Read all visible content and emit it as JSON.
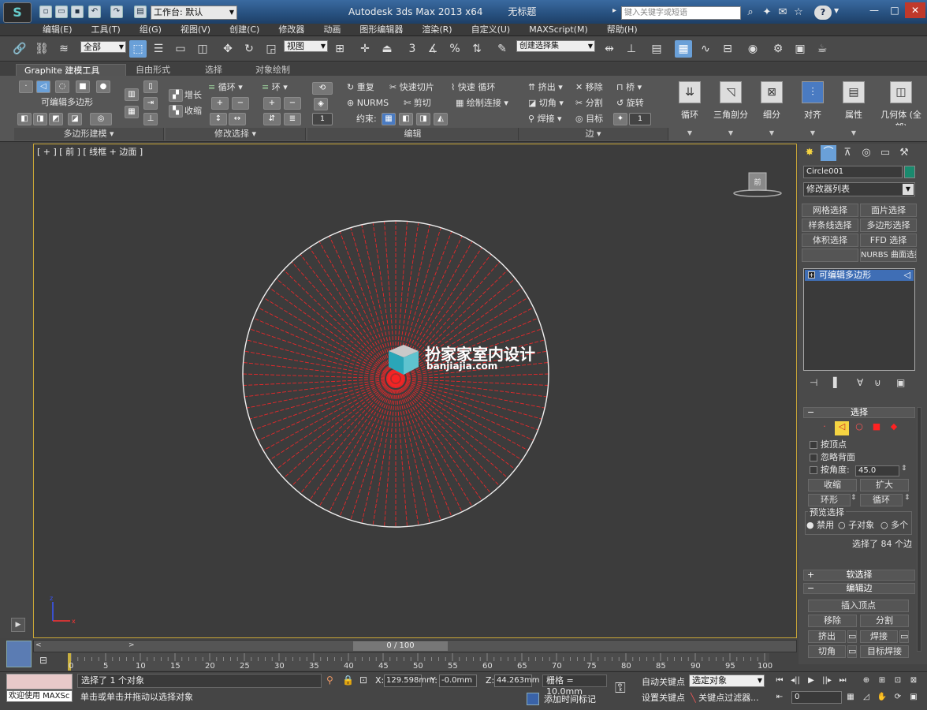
{
  "title_bar": {
    "app_title": "Autodesk 3ds Max  2013 x64",
    "doc_title": "无标题",
    "workspace": "工作台: 默认",
    "search_placeholder": "键入关键字或短语",
    "help": "?"
  },
  "menu": [
    "编辑(E)",
    "工具(T)",
    "组(G)",
    "视图(V)",
    "创建(C)",
    "修改器",
    "动画",
    "图形编辑器",
    "渲染(R)",
    "自定义(U)",
    "MAXScript(M)",
    "帮助(H)"
  ],
  "main_toolbar": {
    "selection_filter": "全部",
    "ref_coord": "视图",
    "named_selection": "创建选择集",
    "snap_angle_label": "3"
  },
  "ribbon": {
    "tabs": [
      "Graphite 建模工具",
      "自由形式",
      "选择",
      "对象绘制"
    ],
    "panels": [
      "多边形建模",
      "修改选择",
      "编辑",
      "边"
    ],
    "poly_modeling": {
      "label": "可编辑多边形"
    },
    "modify_sel": {
      "grow": "增长",
      "shrink": "收缩",
      "loop": "循环",
      "ring": "环"
    },
    "edit": {
      "repeat": "重复",
      "quickslice": "快速切片",
      "quickloop": "快速 循环",
      "nurms": "NURMS",
      "cut": "剪切",
      "paint_connect": "绘制连接",
      "constraint": "约束:",
      "constraint_val": "1"
    },
    "edges": {
      "extrude": "挤出",
      "remove": "移除",
      "bridge": "桥",
      "chamfer": "切角",
      "split": "分割",
      "spin": "旋转",
      "weld": "焊接",
      "target": "目标",
      "spin_val": "1"
    },
    "big_buttons": [
      "循环",
      "三角剖分",
      "细分",
      "对齐",
      "属性",
      "几何体 (全部)"
    ]
  },
  "viewport": {
    "label": "[ + ] [ 前 ] [ 线框 + 边面 ]",
    "watermark_text": "扮家家室内设计",
    "watermark_url": "banjiajia.com",
    "axis_x": "x",
    "axis_z": "z",
    "viewcube": "前",
    "wire_color": "#e8282a",
    "rim_color": "#f0f0f0",
    "spoke_count": 84
  },
  "command_panel": {
    "object_name": "Circle001",
    "object_color": "#1a8a6e",
    "modifier_list": "修改器列表",
    "mod_buttons": [
      "网格选择",
      "面片选择",
      "样条线选择",
      "多边形选择",
      "体积选择",
      "FFD 选择",
      "NURBS 曲面选择"
    ],
    "stack_item": "可编辑多边形",
    "selection": {
      "title": "选择",
      "by_vertex": "按顶点",
      "ignore_backfacing": "忽略背面",
      "by_angle": "按角度:",
      "angle_value": "45.0",
      "shrink": "收缩",
      "grow": "扩大",
      "ring": "环形",
      "loop": "循环",
      "preview": "预览选择",
      "preview_opts": [
        "禁用",
        "子对象",
        "多个"
      ],
      "status": "选择了 84 个边"
    },
    "soft_sel": "软选择",
    "edit_edges": {
      "title": "编辑边",
      "insert_vertex": "插入顶点",
      "remove": "移除",
      "split": "分割",
      "extrude": "挤出",
      "weld": "焊接",
      "chamfer": "切角",
      "target_weld": "目标焊接"
    }
  },
  "timeline": {
    "slider": "0 / 100",
    "ticks": [
      "0",
      "5",
      "10",
      "15",
      "20",
      "25",
      "30",
      "35",
      "40",
      "45",
      "50",
      "55",
      "60",
      "65",
      "70",
      "75",
      "80",
      "85",
      "90",
      "95",
      "100"
    ]
  },
  "status_bar": {
    "maxscript": "欢迎使用 MAXSc",
    "line1": "选择了 1 个对象",
    "line2": "单击或单击并拖动以选择对象",
    "x_label": "X:",
    "x": "129.598mm",
    "y_label": "Y:",
    "y": "-0.0mm",
    "z_label": "Z:",
    "z": "44.263mm",
    "grid": "栅格 = 10.0mm",
    "add_time_tag": "添加时间标记",
    "auto_key": "自动关键点",
    "set_key": "设置关键点",
    "key_mode": "选定对象",
    "key_filters": "关键点过滤器...",
    "frame": "0"
  }
}
